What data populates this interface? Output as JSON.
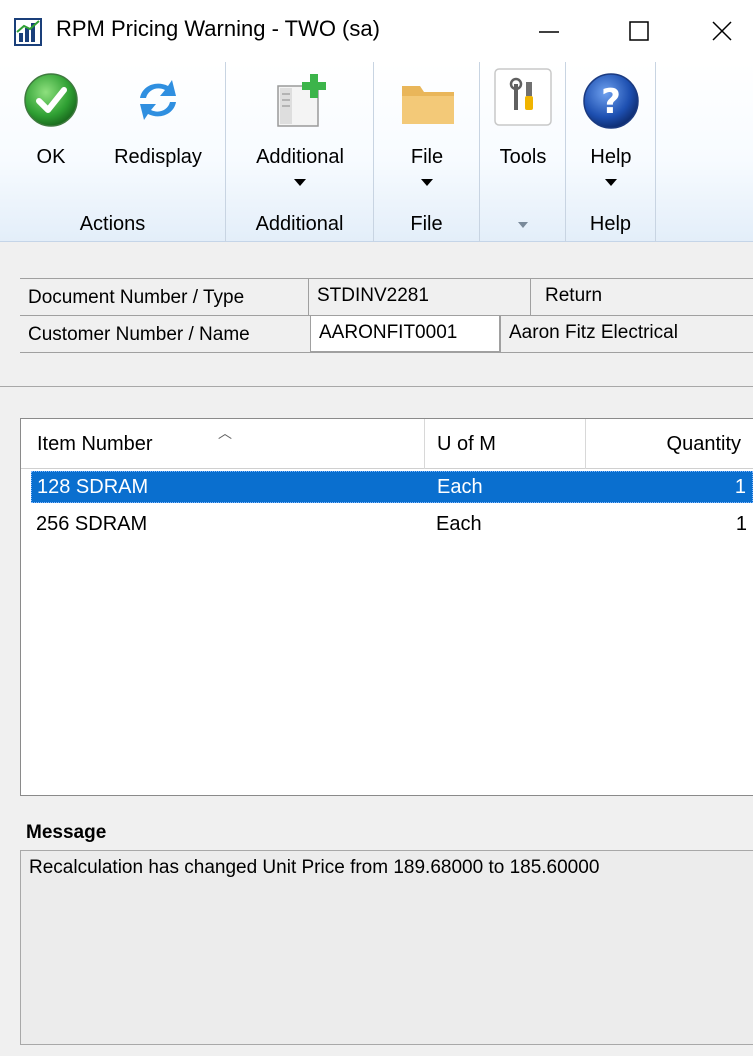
{
  "window": {
    "title": "RPM Pricing Warning  -  TWO (sa)",
    "app_icon": "bar-chart-icon",
    "controls": [
      "minimize-icon",
      "maximize-icon",
      "close-icon"
    ]
  },
  "ribbon": {
    "groups": {
      "actions": {
        "label": "Actions",
        "buttons": {
          "ok": "OK",
          "redisplay": "Redisplay"
        }
      },
      "additional": {
        "label": "Additional",
        "button": "Additional"
      },
      "file": {
        "label": "File",
        "button": "File"
      },
      "tools": {
        "button": "Tools"
      },
      "help": {
        "label": "Help",
        "button": "Help"
      }
    },
    "icons": {
      "ok": "checkmark-icon",
      "redisplay": "refresh-icon",
      "additional": "document-add-icon",
      "file": "folder-icon",
      "tools": "tools-icon",
      "help": "help-icon"
    }
  },
  "header": {
    "document_label": "Document Number / Type",
    "document_number": "STDINV2281",
    "document_type": "Return",
    "customer_label": "Customer Number / Name",
    "customer_number": "AARONFIT0001",
    "customer_name": "Aaron Fitz Electrical"
  },
  "list": {
    "columns": [
      "Item Number",
      "U of M",
      "Quantity"
    ],
    "rows": [
      {
        "item": "128 SDRAM",
        "uom": "Each",
        "qty": "1",
        "selected": true
      },
      {
        "item": "256 SDRAM",
        "uom": "Each",
        "qty": "1",
        "selected": false
      }
    ]
  },
  "message": {
    "label": "Message",
    "text": "Recalculation has changed Unit Price from 189.68000 to 185.60000"
  },
  "colors": {
    "selection": "#0a6fcf",
    "ribbon_bottom": "#e3eef9",
    "ok_green": "#2fa033",
    "help_blue": "#1d4fb0"
  }
}
